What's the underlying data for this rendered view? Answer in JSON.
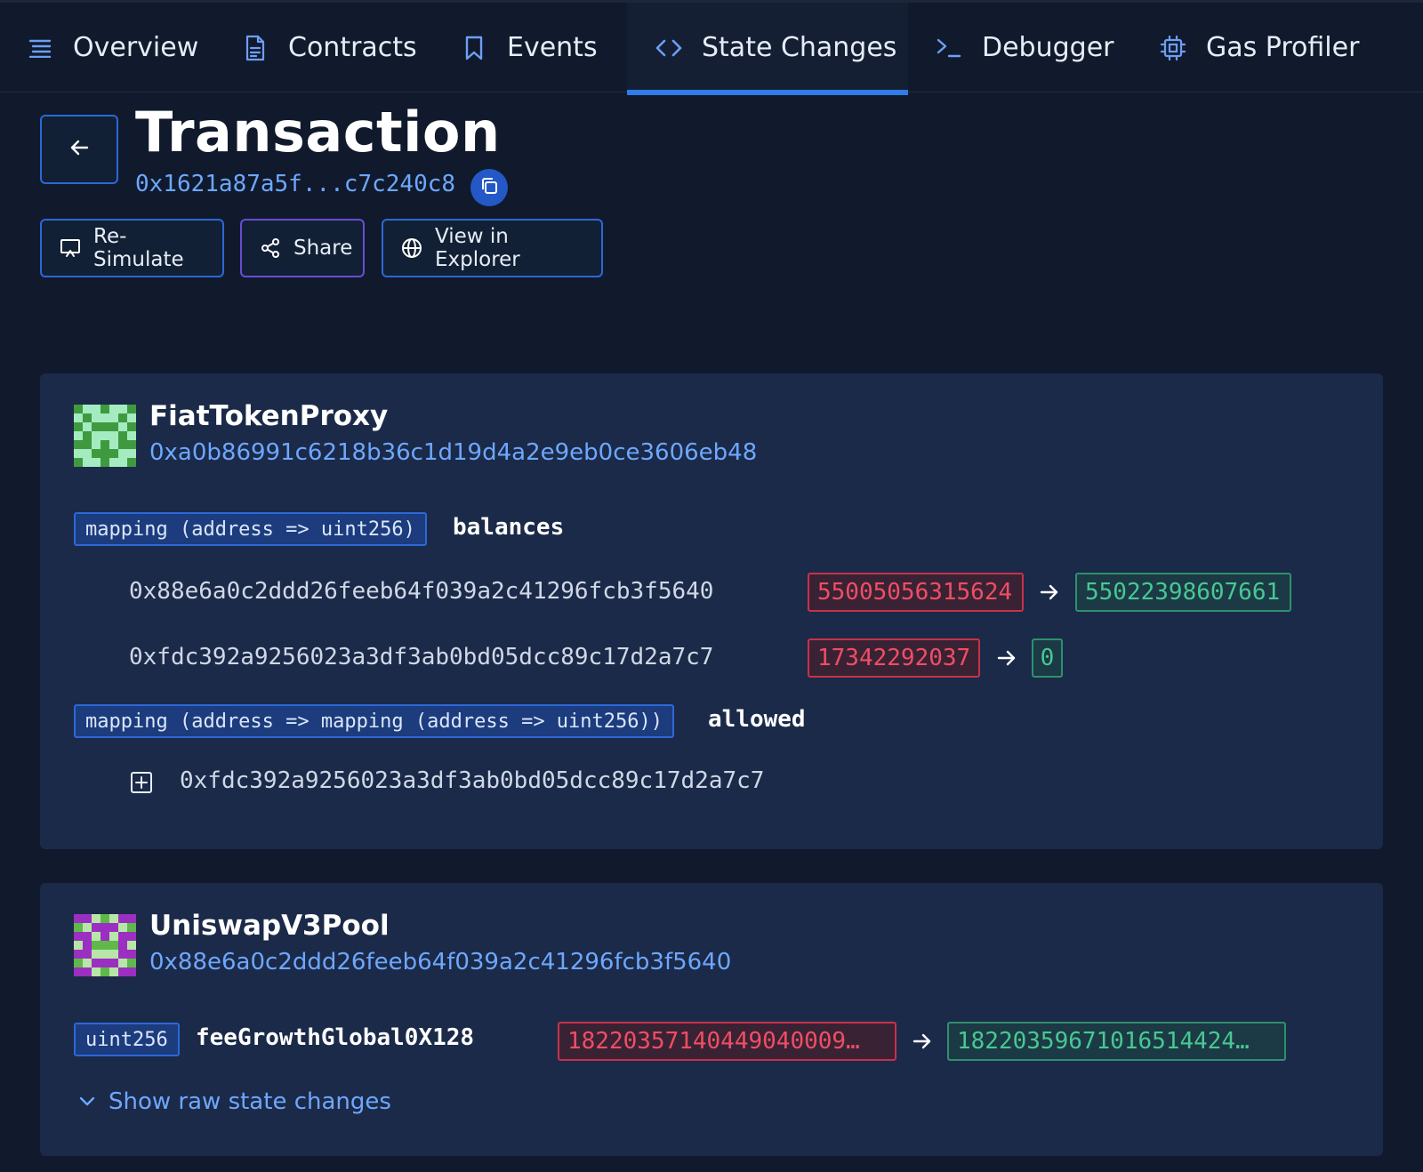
{
  "tabs": [
    {
      "label": "Overview",
      "icon": "list-icon"
    },
    {
      "label": "Contracts",
      "icon": "document-icon"
    },
    {
      "label": "Events",
      "icon": "bookmark-icon"
    },
    {
      "label": "State Changes",
      "icon": "code-icon",
      "active": true
    },
    {
      "label": "Debugger",
      "icon": "terminal-icon"
    },
    {
      "label": "Gas Profiler",
      "icon": "chip-icon"
    }
  ],
  "header": {
    "title": "Transaction",
    "hash": "0x1621a87a5f...c7c240c8"
  },
  "actions": {
    "resimulate": "Re-Simulate",
    "share": "Share",
    "explorer": "View in Explorer"
  },
  "contracts": [
    {
      "name": "FiatTokenProxy",
      "address": "0xa0b86991c6218b36c1d19d4a2e9eb0ce3606eb48",
      "variables": [
        {
          "type": "mapping (address => uint256)",
          "name": "balances",
          "entries": [
            {
              "key": "0x88e6a0c2ddd26feeb64f039a2c41296fcb3f5640",
              "old": "55005056315624",
              "new": "55022398607661"
            },
            {
              "key": "0xfdc392a9256023a3df3ab0bd05dcc89c17d2a7c7",
              "old": "17342292037",
              "new": "0"
            }
          ]
        },
        {
          "type": "mapping (address => mapping (address => uint256))",
          "name": "allowed",
          "entries": [
            {
              "key": "0xfdc392a9256023a3df3ab0bd05dcc89c17d2a7c7",
              "collapsed": true
            }
          ]
        }
      ]
    },
    {
      "name": "UniswapV3Pool",
      "address": "0x88e6a0c2ddd26feeb64f039a2c41296fcb3f5640",
      "variables": [
        {
          "type": "uint256",
          "name": "feeGrowthGlobal0X128",
          "old": "18220357140449040009…",
          "new": "18220359671016514424…"
        }
      ]
    }
  ],
  "raw_toggle": "Show raw state changes",
  "colors": {
    "background": "#101a2c",
    "card": "#1b2a48",
    "accent": "#2f7ce8",
    "link": "#6ea7ff",
    "old_value": "#ef4e64",
    "new_value": "#48c893"
  }
}
